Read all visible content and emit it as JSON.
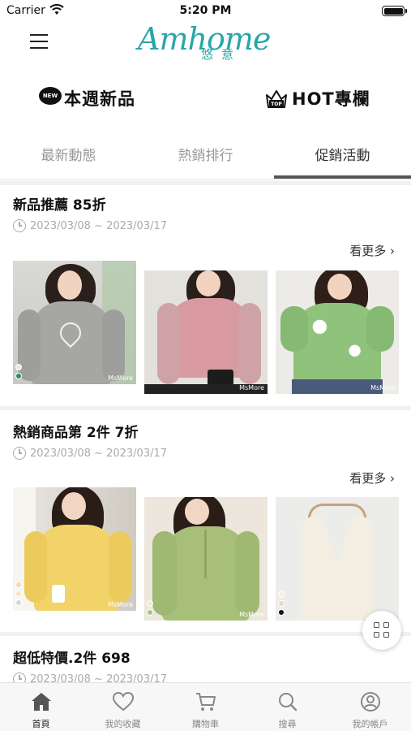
{
  "status_bar": {
    "carrier": "Carrier",
    "time": "5:20 PM"
  },
  "header": {
    "logo_text": "Amhome",
    "logo_subtext": "悠意"
  },
  "features": [
    {
      "badge": "NEW",
      "label": "本週新品",
      "icon": "new-speech-bubble-icon"
    },
    {
      "badge": "TOP",
      "label": "HOT專欄",
      "icon": "crown-top-icon"
    }
  ],
  "tabs": [
    {
      "label": "最新動態",
      "active": false
    },
    {
      "label": "熱銷排行",
      "active": false
    },
    {
      "label": "促銷活動",
      "active": true
    }
  ],
  "promotions": [
    {
      "title": "新品推薦 85折",
      "date_range": "2023/03/08 ~ 2023/03/17",
      "see_more": "看更多 ›",
      "products": [
        {
          "watermark": "MsMore",
          "swatches": [
            "#e8e8e8",
            "#2e8b57"
          ]
        },
        {
          "watermark": "MsMore",
          "swatches": []
        },
        {
          "watermark": "MsMore",
          "swatches": []
        }
      ]
    },
    {
      "title": "熱銷商品第 2件 7折",
      "date_range": "2023/03/08 ~ 2023/03/17",
      "see_more": "看更多 ›",
      "products": [
        {
          "watermark": "MsMore",
          "swatches": [
            "#f3d8a8",
            "#f5e6b8",
            "#cfd8e0"
          ]
        },
        {
          "watermark": "MsMore",
          "swatches": [
            "#f3e9c8",
            "#a8c47a"
          ]
        },
        {
          "watermark": "",
          "swatches": [
            "#f5eee3",
            "#e8d6c0",
            "#111111"
          ]
        }
      ]
    },
    {
      "title": "超低特價.2件 698",
      "date_range": "2023/03/08 ~ 2023/03/17"
    }
  ],
  "tabbar": [
    {
      "label": "首頁",
      "icon": "home-icon",
      "active": true
    },
    {
      "label": "我的收藏",
      "icon": "heart-icon",
      "active": false
    },
    {
      "label": "購物車",
      "icon": "cart-icon",
      "active": false
    },
    {
      "label": "搜尋",
      "icon": "search-icon",
      "active": false
    },
    {
      "label": "我的帳戶",
      "icon": "user-account-icon",
      "active": false
    }
  ],
  "colors": {
    "brand": "#2aa6a8",
    "tab_indicator": "#555555",
    "muted_text": "#aaaaaa"
  }
}
